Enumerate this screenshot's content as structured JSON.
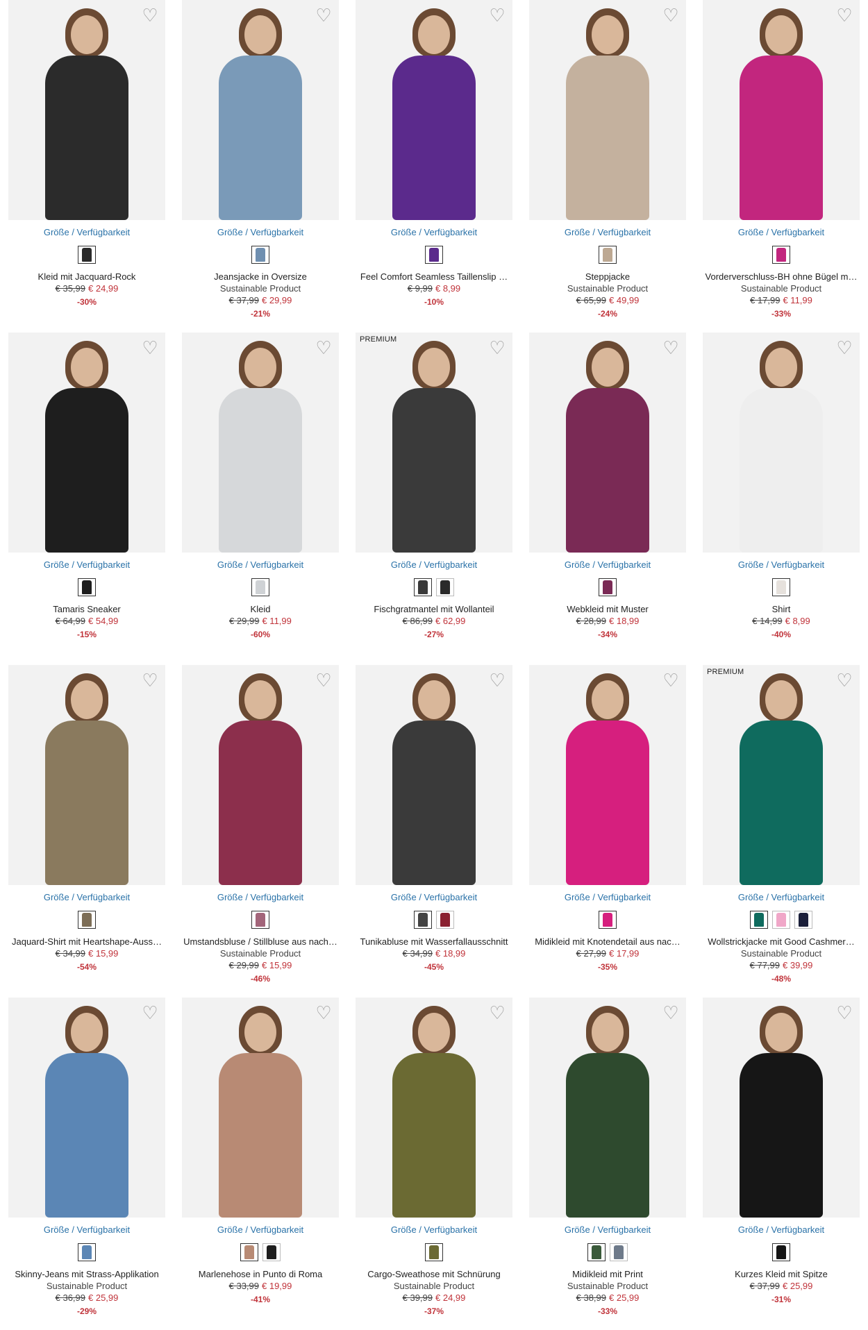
{
  "size_link_label": "Größe / Verfügbarkeit",
  "heart_glyph": "♡",
  "products": [
    {
      "title": "Kleid mit Jacquard-Rock",
      "sustainable": "",
      "old_price": "€ 35,99",
      "new_price": "€ 24,99",
      "discount": "-30%",
      "premium": "",
      "color": "#2b2b2b",
      "swatches": [
        "#2a2a2a"
      ]
    },
    {
      "title": "Jeansjacke in Oversize",
      "sustainable": "Sustainable Product",
      "old_price": "€ 37,99",
      "new_price": "€ 29,99",
      "discount": "-21%",
      "premium": "",
      "color": "#7a9ab8",
      "swatches": [
        "#6f8fb0"
      ]
    },
    {
      "title": "Feel Comfort Seamless Taillenslip …",
      "sustainable": "",
      "old_price": "€ 9,99",
      "new_price": "€ 8,99",
      "discount": "-10%",
      "premium": "",
      "color": "#5b2a8c",
      "swatches": [
        "#5b2a8c"
      ]
    },
    {
      "title": "Steppjacke",
      "sustainable": "Sustainable Product",
      "old_price": "€ 65,99",
      "new_price": "€ 49,99",
      "discount": "-24%",
      "premium": "",
      "color": "#c4b19e",
      "swatches": [
        "#bda892"
      ]
    },
    {
      "title": "Vorderverschluss-BH ohne Bügel m…",
      "sustainable": "Sustainable Product",
      "old_price": "€ 17,99",
      "new_price": "€ 11,99",
      "discount": "-33%",
      "premium": "",
      "color": "#c2267e",
      "swatches": [
        "#c2267e"
      ]
    },
    {
      "title": "Tamaris Sneaker",
      "sustainable": "",
      "old_price": "€ 64,99",
      "new_price": "€ 54,99",
      "discount": "-15%",
      "premium": "",
      "color": "#1e1e1e",
      "swatches": [
        "#1e1e1e"
      ]
    },
    {
      "title": "Kleid",
      "sustainable": "",
      "old_price": "€ 29,99",
      "new_price": "€ 11,99",
      "discount": "-60%",
      "premium": "",
      "color": "#d6d8da",
      "swatches": [
        "#cfd2d5"
      ]
    },
    {
      "title": "Fischgratmantel mit Wollanteil",
      "sustainable": "",
      "old_price": "€ 86,99",
      "new_price": "€ 62,99",
      "discount": "-27%",
      "premium": "PREMIUM",
      "color": "#3a3a3a",
      "swatches": [
        "#3a3a3a",
        "#2a2a2a"
      ]
    },
    {
      "title": "Webkleid mit Muster",
      "sustainable": "",
      "old_price": "€ 28,99",
      "new_price": "€ 18,99",
      "discount": "-34%",
      "premium": "",
      "color": "#7a2a55",
      "swatches": [
        "#7a2a55"
      ]
    },
    {
      "title": "Shirt",
      "sustainable": "",
      "old_price": "€ 14,99",
      "new_price": "€ 8,99",
      "discount": "-40%",
      "premium": "",
      "color": "#eeeeee",
      "swatches": [
        "#e6e1dc"
      ]
    },
    {
      "title": "Jaquard-Shirt mit Heartshape-Auss…",
      "sustainable": "",
      "old_price": "€ 34,99",
      "new_price": "€ 15,99",
      "discount": "-54%",
      "premium": "",
      "color": "#8a7a5e",
      "swatches": [
        "#7d6e57"
      ]
    },
    {
      "title": "Umstandsbluse / Stillbluse aus nach…",
      "sustainable": "Sustainable Product",
      "old_price": "€ 29,99",
      "new_price": "€ 15,99",
      "discount": "-46%",
      "premium": "",
      "color": "#8c2f4c",
      "swatches": [
        "#a3657a"
      ]
    },
    {
      "title": "Tunikabluse mit Wasserfallausschnitt",
      "sustainable": "",
      "old_price": "€ 34,99",
      "new_price": "€ 18,99",
      "discount": "-45%",
      "premium": "",
      "color": "#3a3a3a",
      "swatches": [
        "#444444",
        "#8a2030"
      ]
    },
    {
      "title": "Midikleid mit Knotendetail aus nac…",
      "sustainable": "",
      "old_price": "€ 27,99",
      "new_price": "€ 17,99",
      "discount": "-35%",
      "premium": "",
      "color": "#d61f7e",
      "swatches": [
        "#d61f7e"
      ]
    },
    {
      "title": "Wollstrickjacke mit Good Cashmer…",
      "sustainable": "Sustainable Product",
      "old_price": "€ 77,99",
      "new_price": "€ 39,99",
      "discount": "-48%",
      "premium": "PREMIUM",
      "color": "#0f6b5e",
      "swatches": [
        "#0f6b5e",
        "#f0a7c8",
        "#1b1f3a"
      ]
    },
    {
      "title": "Skinny-Jeans mit Strass-Applikation",
      "sustainable": "Sustainable Product",
      "old_price": "€ 36,99",
      "new_price": "€ 25,99",
      "discount": "-29%",
      "premium": "",
      "color": "#5b86b5",
      "swatches": [
        "#5b86b5"
      ]
    },
    {
      "title": "Marlenehose in Punto di Roma",
      "sustainable": "",
      "old_price": "€ 33,99",
      "new_price": "€ 19,99",
      "discount": "-41%",
      "premium": "",
      "color": "#b88a74",
      "swatches": [
        "#b88a74",
        "#1e1e1e"
      ]
    },
    {
      "title": "Cargo-Sweathose mit Schnürung",
      "sustainable": "Sustainable Product",
      "old_price": "€ 39,99",
      "new_price": "€ 24,99",
      "discount": "-37%",
      "premium": "",
      "color": "#6b6a33",
      "swatches": [
        "#6b6a33"
      ]
    },
    {
      "title": "Midikleid mit Print",
      "sustainable": "Sustainable Product",
      "old_price": "€ 38,99",
      "new_price": "€ 25,99",
      "discount": "-33%",
      "premium": "",
      "color": "#2e4a2e",
      "swatches": [
        "#3a5a3a",
        "#6e7a8a"
      ]
    },
    {
      "title": "Kurzes Kleid mit Spitze",
      "sustainable": "",
      "old_price": "€ 37,99",
      "new_price": "€ 25,99",
      "discount": "-31%",
      "premium": "",
      "color": "#161616",
      "swatches": [
        "#161616"
      ]
    }
  ]
}
